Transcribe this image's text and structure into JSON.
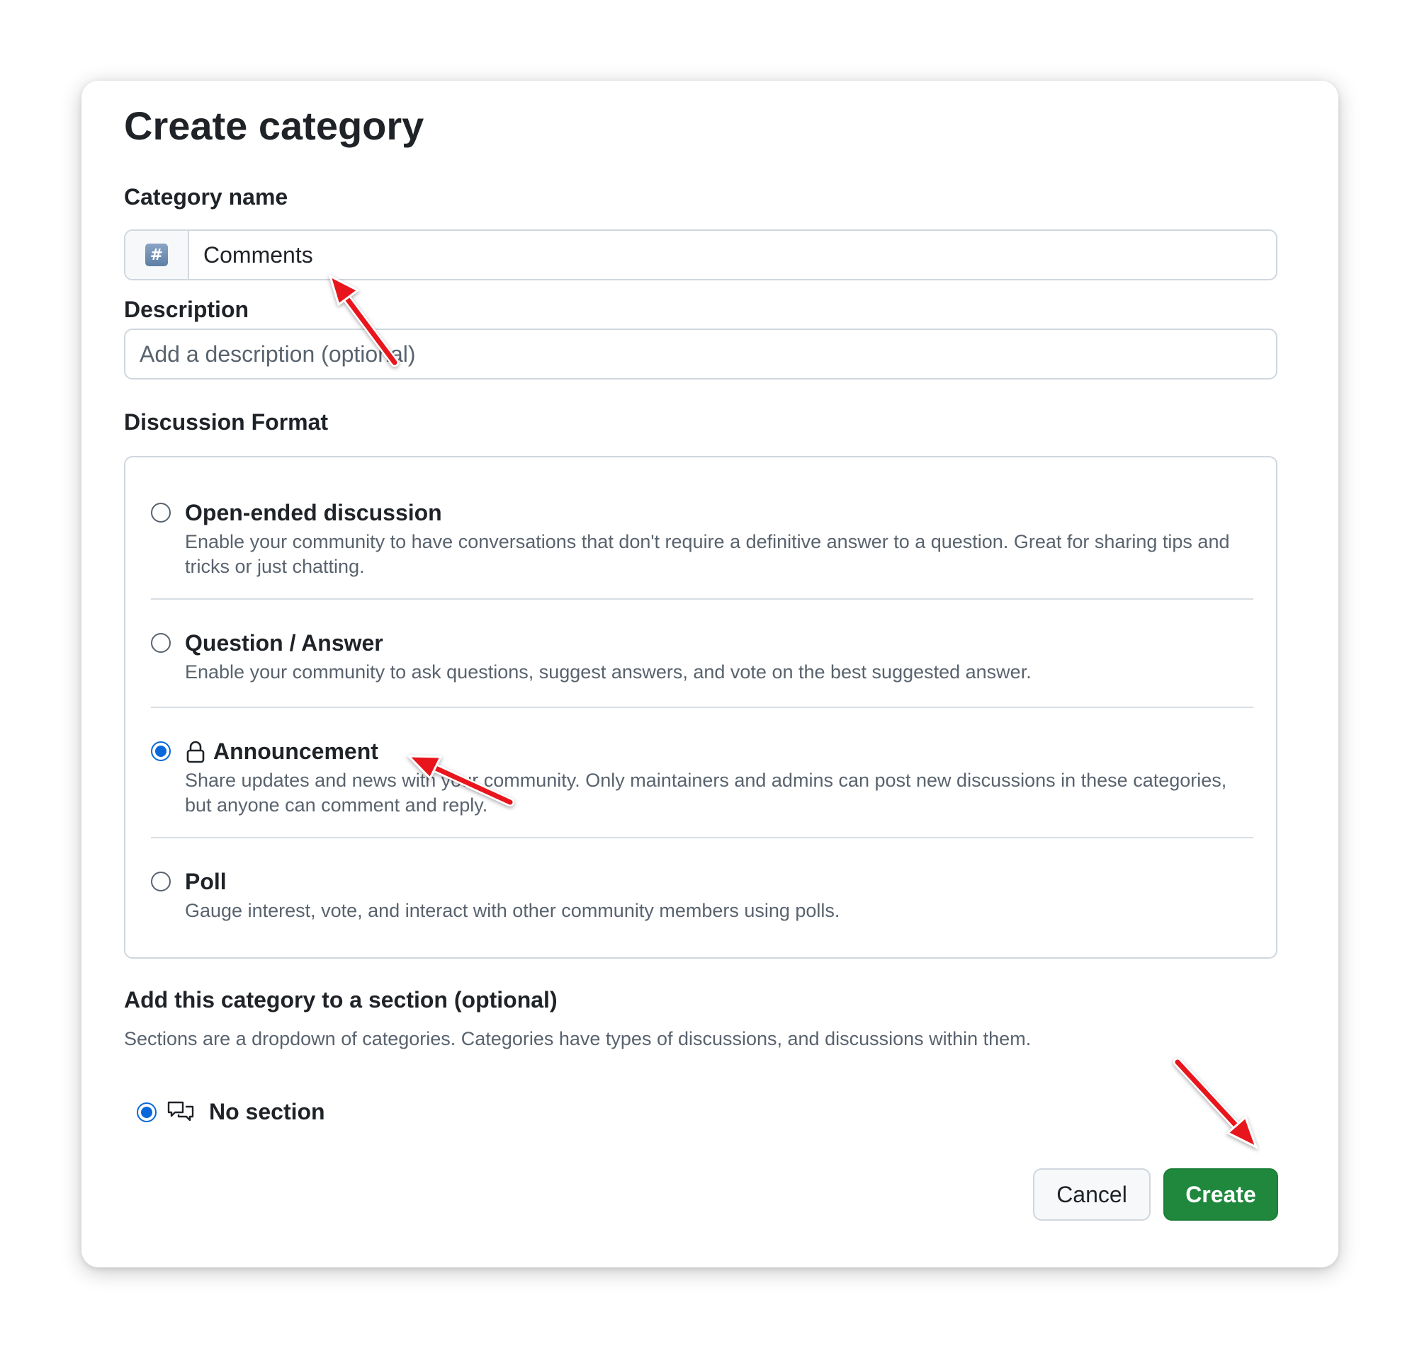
{
  "dialog": {
    "title": "Create category",
    "category_name_label": "Category name",
    "category_name_value": "Comments",
    "category_emoji_icon": "hash-keycap-icon",
    "description_label": "Description",
    "description_placeholder": "Add a description (optional)",
    "discussion_format_label": "Discussion Format",
    "formats": [
      {
        "title": "Open-ended discussion",
        "description": "Enable your community to have conversations that don't require a definitive answer to a question. Great for sharing tips and tricks or just chatting.",
        "selected": false
      },
      {
        "title": "Question / Answer",
        "description": "Enable your community to ask questions, suggest answers, and vote on the best suggested answer.",
        "selected": false
      },
      {
        "title": "Announcement",
        "icon": "lock-icon",
        "description": "Share updates and news with your community. Only maintainers and admins can post new discussions in these categories, but anyone can comment and reply.",
        "selected": true
      },
      {
        "title": "Poll",
        "description": "Gauge interest, vote, and interact with other community members using polls.",
        "selected": false
      }
    ],
    "section_heading": "Add this category to a section (optional)",
    "section_hint": "Sections are a dropdown of categories. Categories have types of discussions, and discussions within them.",
    "section_option": {
      "label": "No section",
      "icon": "comment-discussion-icon",
      "selected": true
    },
    "cancel_label": "Cancel",
    "create_label": "Create"
  },
  "colors": {
    "accent_blue": "#0969da",
    "create_green": "#1f883d",
    "annotation_red": "#e8121a"
  }
}
